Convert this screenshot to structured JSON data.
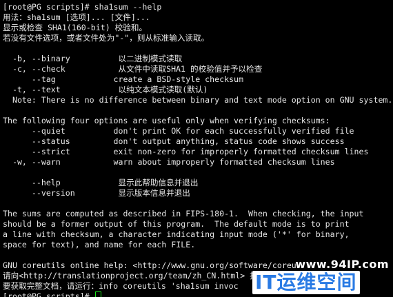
{
  "terminal": {
    "lines": [
      "[root@PG scripts]# sha1sum --help",
      "用法：sha1sum [选项]... [文件]...",
      "显示或检查 SHA1(160-bit) 校验和。",
      "若没有文件选项，或者文件处为\"-\"，则从标准输入读取。",
      "",
      "  -b, --binary          以二进制模式读取",
      "  -c, --check           从文件中读取SHA1 的校验值并予以检查",
      "      --tag            create a BSD-style checksum",
      "  -t, --text            以纯文本模式读取(默认)",
      "  Note: There is no difference between binary and text mode option on GNU system.",
      "",
      "The following four options are useful only when verifying checksums:",
      "      --quiet          don't print OK for each successfully verified file",
      "      --status         don't output anything, status code shows success",
      "      --strict         exit non-zero for improperly formatted checksum lines",
      "  -w, --warn           warn about improperly formatted checksum lines",
      "",
      "      --help            显示此帮助信息并退出",
      "      --version         显示版本信息并退出",
      "",
      "The sums are computed as described in FIPS-180-1.  When checking, the input",
      "should be a former output of this program.  The default mode is to print",
      "a line with checksum, a character indicating input mode ('*' for binary,",
      "space for text), and name for each FILE.",
      "",
      "GNU coreutils online help: <http://www.gnu.org/software/coreu",
      "请向<http://translationproject.org/team/zh_CN.html> 报告sh",
      "要获取完整文档，请运行：info coreutils 'sha1sum invoc"
    ],
    "prompt": "[root@PG scripts]# ",
    "cursor_color": "#19e619"
  },
  "watermark": {
    "url": "www.94IP.com",
    "logo_prefix": "IT",
    "logo_text": "运维空间"
  }
}
